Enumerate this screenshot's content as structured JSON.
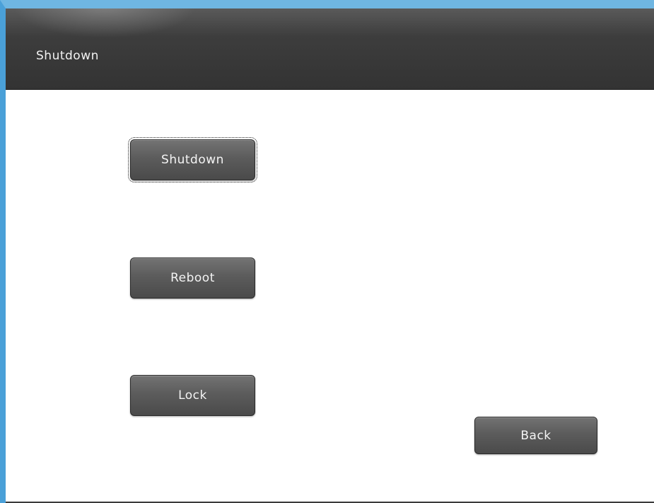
{
  "header": {
    "title": "Shutdown"
  },
  "buttons": {
    "shutdown_label": "Shutdown",
    "reboot_label": "Reboot",
    "lock_label": "Lock",
    "back_label": "Back"
  },
  "focus": "shutdown",
  "colors": {
    "header_bg": "#333333",
    "button_bg": "#5c5c5c",
    "button_text": "#f4f4f4",
    "frame_accent": "#4aa0d8",
    "content_bg": "#ffffff"
  }
}
